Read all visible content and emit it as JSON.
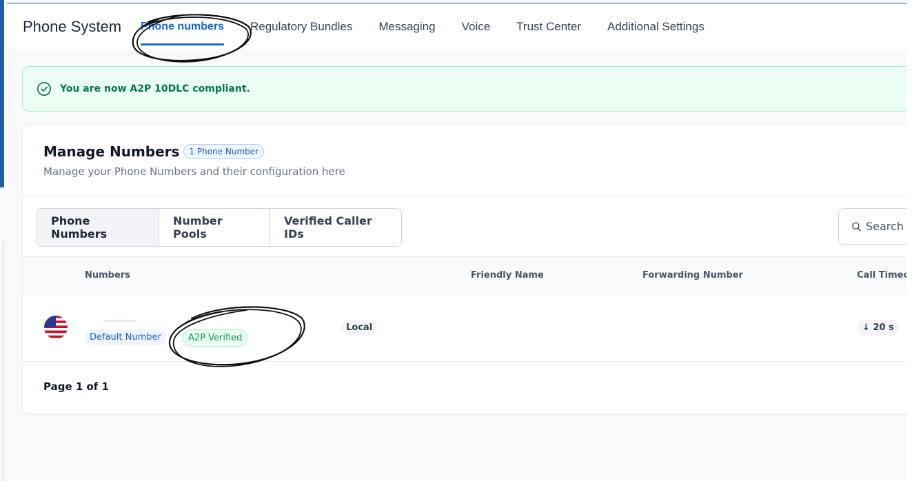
{
  "topnav": {
    "title": "Phone System",
    "tabs": [
      {
        "label": "Phone numbers",
        "active": true
      },
      {
        "label": "Regulatory Bundles"
      },
      {
        "label": "Messaging"
      },
      {
        "label": "Voice"
      },
      {
        "label": "Trust Center"
      },
      {
        "label": "Additional Settings"
      }
    ]
  },
  "banner": {
    "icon": "check-circle-icon",
    "text": "You are now A2P 10DLC compliant.",
    "color": "#027a48"
  },
  "card": {
    "title": "Manage Numbers",
    "count_badge": "1 Phone Number",
    "subtitle": "Manage your Phone Numbers and their configuration here",
    "segments": [
      "Phone Numbers",
      "Number Pools",
      "Verified Caller IDs"
    ],
    "active_segment": "Phone Numbers",
    "search": {
      "placeholder": "Search",
      "icon": "search-icon"
    },
    "columns": [
      "Numbers",
      "Friendly Name",
      "Forwarding Number",
      "Call Timeo"
    ],
    "rows": [
      {
        "flag": "us-flag-icon",
        "badges": [
          "Default Number",
          "A2P Verified"
        ],
        "type": "Local",
        "call_timeout": "20 s",
        "timeout_icon": "arrow-down-icon"
      }
    ],
    "pager": "Page 1 of 1"
  },
  "colors": {
    "accent": "#1565d8",
    "success": "#027a48",
    "annotation": "#111111"
  }
}
